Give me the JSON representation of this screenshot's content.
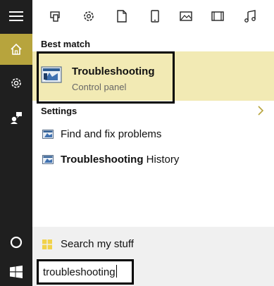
{
  "rail": {
    "items": [
      "menu-icon",
      "home-icon",
      "settings-gear-icon",
      "feedback-icon",
      "cortana-circle-icon",
      "windows-start-icon"
    ],
    "active": "home-icon",
    "accent": "#b7a43d",
    "background": "#1f1f1f"
  },
  "filters": [
    "apps-icon",
    "settings-icon",
    "documents-icon",
    "tablet-icon",
    "photos-icon",
    "videos-icon",
    "music-icon"
  ],
  "best_match": {
    "heading": "Best match",
    "title": "Troubleshooting",
    "subtitle": "Control panel",
    "highlight_color": "#f2eab4"
  },
  "settings": {
    "heading": "Settings",
    "items": [
      {
        "bold": "",
        "text": "Find and fix problems"
      },
      {
        "bold": "Troubleshooting",
        "text": " History"
      }
    ]
  },
  "search": {
    "my_stuff_label": "Search my stuff",
    "query": "troubleshooting"
  }
}
